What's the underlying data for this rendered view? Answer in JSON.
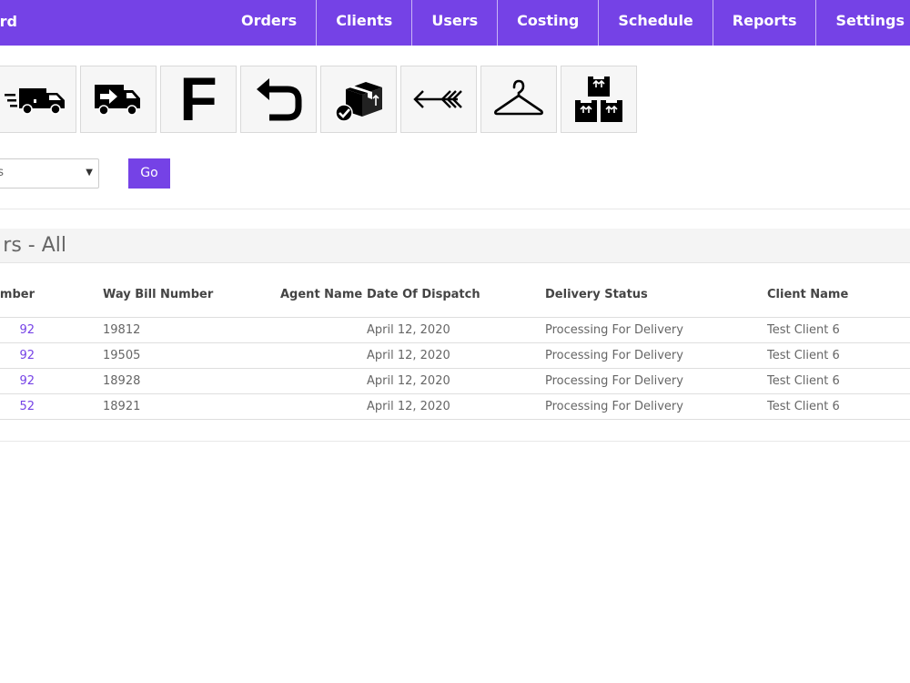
{
  "app": {
    "brand": "rd"
  },
  "nav": {
    "items": [
      {
        "label": "Orders"
      },
      {
        "label": "Clients"
      },
      {
        "label": "Users"
      },
      {
        "label": "Costing"
      },
      {
        "label": "Schedule"
      },
      {
        "label": "Reports"
      },
      {
        "label": "Settings"
      }
    ]
  },
  "toolbar": {
    "icons": [
      "fast-delivery-truck-icon",
      "dispatch-truck-icon",
      "letter-f-icon",
      "return-arrow-icon",
      "delivered-box-icon",
      "arrow-left-icon",
      "hanger-icon",
      "stacked-boxes-icon"
    ],
    "f_glyph": "F"
  },
  "filter": {
    "selected": "ts",
    "go_label": "Go"
  },
  "section": {
    "title": "rs - All"
  },
  "table": {
    "headers": {
      "order": "umber",
      "waybill": "Way Bill Number",
      "agent": "Agent Name",
      "date": "Date Of Dispatch",
      "status": "Delivery Status",
      "client": "Client Name"
    },
    "rows": [
      {
        "order": "92",
        "waybill": "19812",
        "agent": "",
        "date": "April 12, 2020",
        "status": "Processing For Delivery",
        "client": "Test Client 6"
      },
      {
        "order": "92",
        "waybill": "19505",
        "agent": "",
        "date": "April 12, 2020",
        "status": "Processing For Delivery",
        "client": "Test Client 6"
      },
      {
        "order": "92",
        "waybill": "18928",
        "agent": "",
        "date": "April 12, 2020",
        "status": "Processing For Delivery",
        "client": "Test Client 6"
      },
      {
        "order": "52",
        "waybill": "18921",
        "agent": "",
        "date": "April 12, 2020",
        "status": "Processing For Delivery",
        "client": "Test Client 6"
      }
    ]
  },
  "colors": {
    "accent": "#7542e6",
    "link": "#7542e6"
  }
}
